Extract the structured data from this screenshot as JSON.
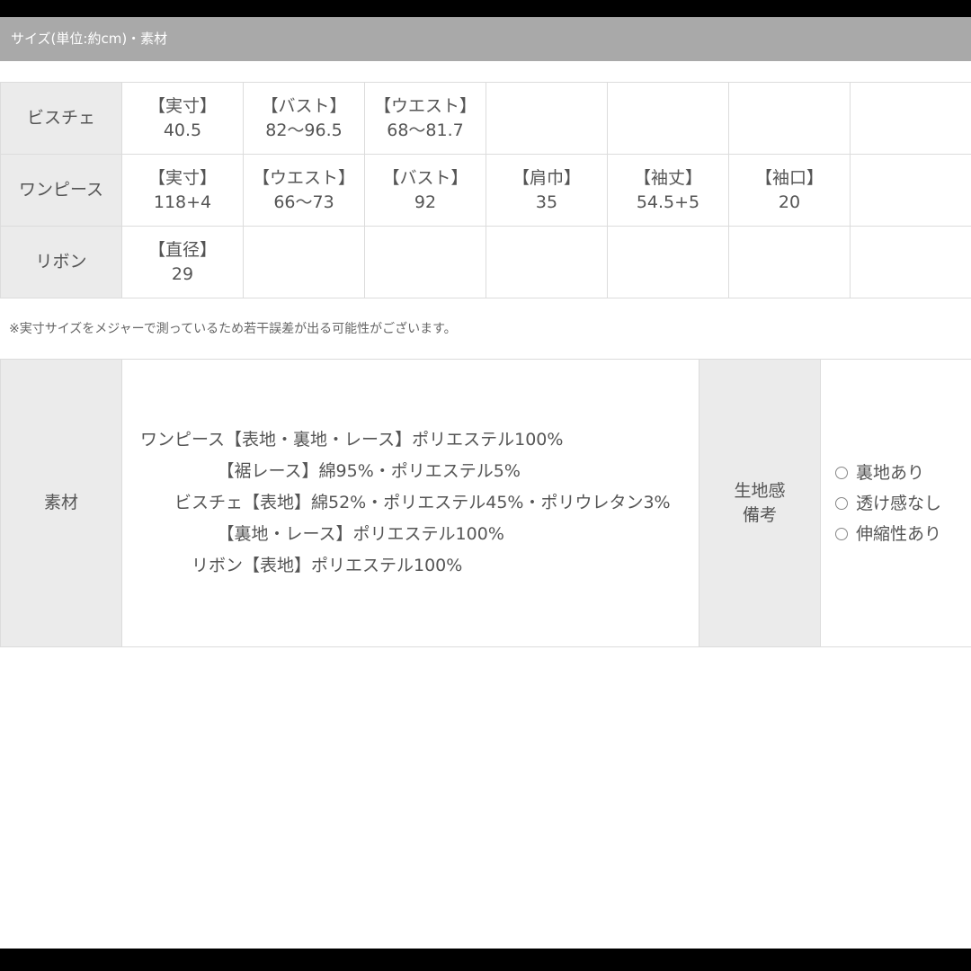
{
  "header": {
    "title": "サイズ(単位:約cm)・素材"
  },
  "size_rows": [
    {
      "item": "ビスチェ",
      "cells": [
        {
          "label": "【実寸】",
          "value": "40.5"
        },
        {
          "label": "【バスト】",
          "value": "82〜96.5"
        },
        {
          "label": "【ウエスト】",
          "value": "68〜81.7"
        }
      ]
    },
    {
      "item": "ワンピース",
      "cells": [
        {
          "label": "【実寸】",
          "value": "118+4"
        },
        {
          "label": "【ウエスト】",
          "value": "66〜73"
        },
        {
          "label": "【バスト】",
          "value": "92"
        },
        {
          "label": "【肩巾】",
          "value": "35"
        },
        {
          "label": "【袖丈】",
          "value": "54.5+5"
        },
        {
          "label": "【袖口】",
          "value": "20"
        }
      ]
    },
    {
      "item": "リボン",
      "cells": [
        {
          "label": "【直径】",
          "value": "29"
        }
      ]
    }
  ],
  "note": "※実寸サイズをメジャーで測っているため若干誤差が出る可能性がございます。",
  "material": {
    "heading": "素材",
    "lines": [
      "ワンピース【表地・裏地・レース】ポリエステル100%",
      "　　　　　【裾レース】綿95%・ポリエステル5%",
      "　　ビスチェ【表地】綿52%・ポリエステル45%・ポリウレタン3%",
      "　　　　　【裏地・レース】ポリエステル100%",
      "　　　リボン【表地】ポリエステル100%"
    ],
    "feel_heading_1": "生地感",
    "feel_heading_2": "備考",
    "remarks": [
      "裏地あり",
      "透け感なし",
      "伸縮性あり"
    ]
  }
}
